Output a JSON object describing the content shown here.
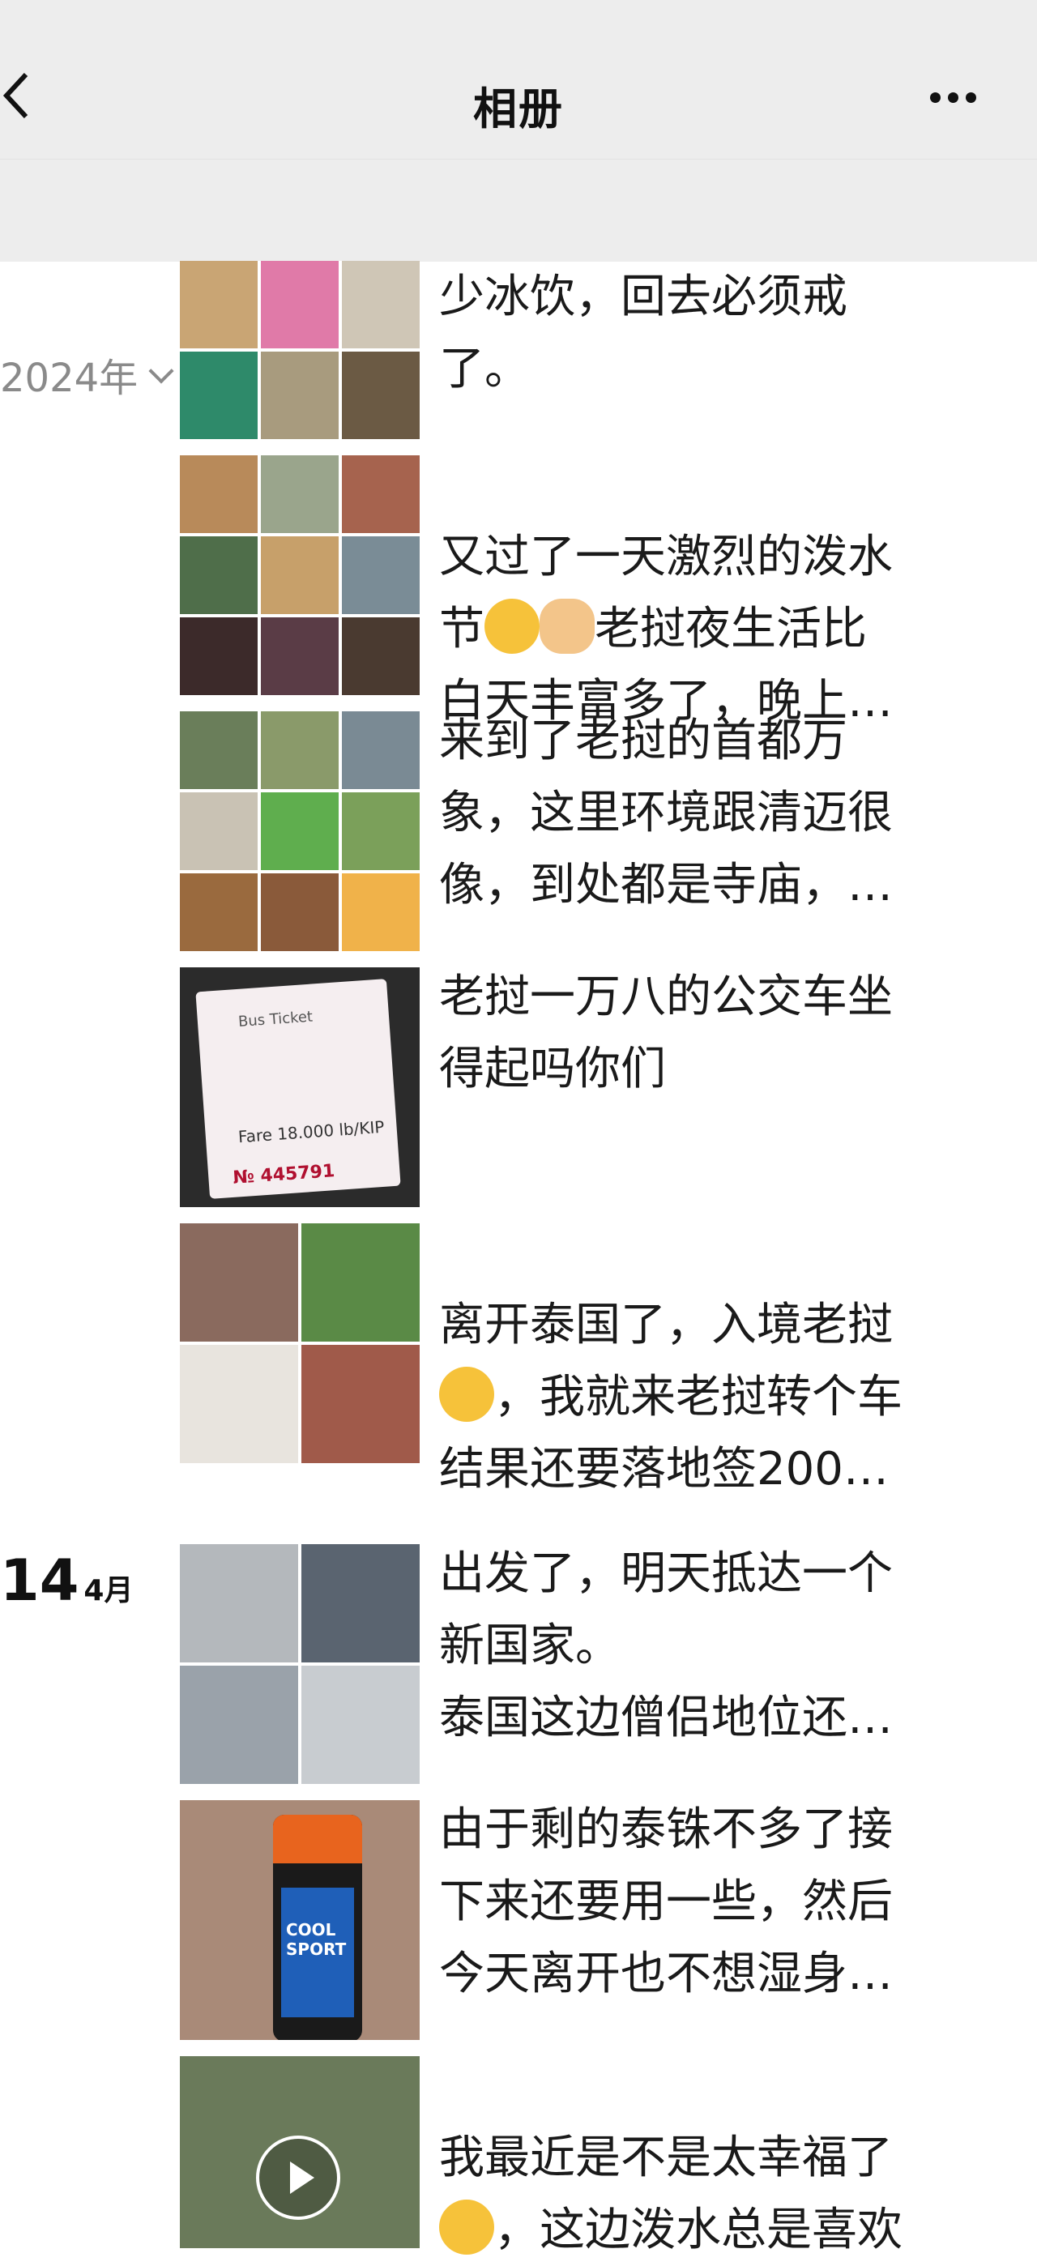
{
  "header": {
    "title": "相册",
    "back_icon": "chevron-left-icon",
    "more_icon": "more-dots-icon"
  },
  "year_selector": {
    "label": "2024年",
    "icon": "chevron-down-icon"
  },
  "day_group": {
    "day": "14",
    "month": "4月"
  },
  "entries": [
    {
      "text": "少冰饮，回去必须戒\n了。"
    },
    {
      "text": "又过了一天激烈的泼水\n节",
      "text2": "老挝夜生活比\n白天丰富多了，晚上…"
    },
    {
      "text": "来到了老挝的首都万\n象，这里环境跟清迈很\n像，到处都是寺庙，…"
    },
    {
      "text": "老挝一万八的公交车坐\n得起吗你们",
      "ticket": {
        "title": "Bus Ticket",
        "fare": "Fare 18.000 lb/KIP",
        "number": "№ 445791"
      }
    },
    {
      "text": "离开泰国了，入境老挝\n",
      "text2": "，我就来老挝转个车\n结果还要落地签200…"
    },
    {
      "text": "出发了，明天抵达一个\n新国家。\n泰国这边僧侣地位还…"
    },
    {
      "text": "由于剩的泰铢不多了接\n下来还要用一些，然后\n今天离开也不想湿身…",
      "bottle": {
        "label": "COOL SPORT"
      }
    },
    {
      "text": "我最近是不是太幸福了\n",
      "text2": "，这边泼水总是喜欢"
    }
  ],
  "colors": {
    "header_bg": "#ededed",
    "text": "#1a1a1a",
    "muted": "#8a8a8a"
  }
}
